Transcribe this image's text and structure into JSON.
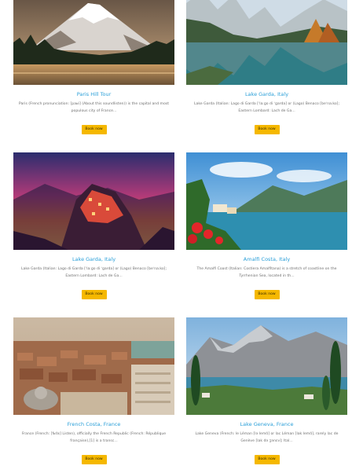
{
  "cards": [
    {
      "title": "Paris Hill Tour",
      "description": "Paris (French pronunciation: [paʁi] (About this soundlisten)) is the capital and most populous city of France...",
      "button": "Book now",
      "image": "snowy-mountain-lake-photo"
    },
    {
      "title": "Lake Garda, Italy",
      "description": "Lake Garda (Italian: Lago di Garda [ˈlaːɡo di ˈɡarda] or (Lago) Benaco [beˈnaːko]; Eastern Lombard: Lach de Ga...",
      "button": "Book now",
      "image": "mountain-lake-reflection-photo"
    },
    {
      "title": "Lake Garda, Italy",
      "description": "Lake Garda (Italian: Lago di Garda [ˈlaːɡo di ˈɡarda] or (Lago) Benaco [beˈnaːko]; Eastern Lombard: Lach de Ga...",
      "button": "Book now",
      "image": "coastal-village-sunset-photo"
    },
    {
      "title": "Amalfi Costa, Italy",
      "description": "The Amalfi Coast (Italian: Costiera Amalfitana) is a stretch of coastline on the Tyrrhenian Sea, located in th...",
      "button": "Book now",
      "image": "lakeside-flowers-photo"
    },
    {
      "title": "French Costa, France",
      "description": "France (French: [fʁɑ̃s] Listen), officially the French Republic (French: République française),[1] is a transc...",
      "button": "Book now",
      "image": "city-aerial-view-photo"
    },
    {
      "title": "Lake Geneva, France",
      "description": "Lake Geneva (French: le Léman [lə lemɑ̃] or lac Léman [lak lemɑ̃], rarely lac de Genève [lak də ʒənɛv]; Ital...",
      "button": "Book now",
      "image": "alpine-lake-cypress-photo"
    }
  ]
}
